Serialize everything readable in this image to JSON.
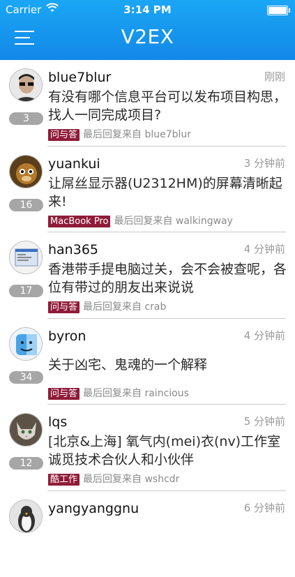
{
  "status": {
    "carrier": "Carrier",
    "time": "3:14 PM",
    "battery_level": 1.0
  },
  "header": {
    "title": "V2EX"
  },
  "icons": {
    "menu": "menu-icon",
    "wifi": "wifi-icon",
    "battery": "battery-icon"
  },
  "colors": {
    "header": "#1289e8",
    "tag": "#8f1b38",
    "badge": "#a6a6a6"
  },
  "reply_prefix": "最后回复来自",
  "topics": [
    {
      "user": "blue7blur",
      "time": "刚刚",
      "title": "有没有哪个信息平台可以发布项目构思，找人一同完成项目?",
      "replies": "3",
      "node": "问与答",
      "last_reply": "blue7blur"
    },
    {
      "user": "yuankui",
      "time": "3 分钟前",
      "title": "让屌丝显示器(U2312HM)的屏幕清晰起来!",
      "replies": "16",
      "node": "MacBook Pro",
      "last_reply": "walkingway"
    },
    {
      "user": "han365",
      "time": "4 分钟前",
      "title": "香港带手提电脑过关，会不会被查呢，各位有带过的朋友出来说说",
      "replies": "17",
      "node": "问与答",
      "last_reply": "crab"
    },
    {
      "user": "byron",
      "time": "4 分钟前",
      "title": "关于凶宅、鬼魂的一个解释",
      "replies": "34",
      "node": "问与答",
      "last_reply": "raincious"
    },
    {
      "user": "lqs",
      "time": "5 分钟前",
      "title": "[北京&上海] 氧气内(mei)衣(nv)工作室 诚觅技术合伙人和小伙伴",
      "replies": "12",
      "node": "酷工作",
      "last_reply": "wshcdr"
    },
    {
      "user": "yangyanggnu",
      "time": "6 分钟前"
    }
  ]
}
